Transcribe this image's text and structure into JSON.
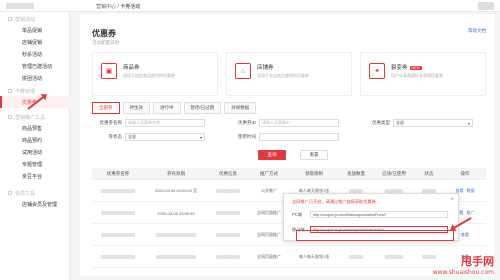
{
  "breadcrumb": {
    "root": "营销中心",
    "sep": "/",
    "current": "卡券活动"
  },
  "sidebar": {
    "group1": {
      "label": "营销活动",
      "items": [
        {
          "label": "单品促销"
        },
        {
          "label": "店铺促销"
        },
        {
          "label": "秒杀活动"
        },
        {
          "label": "管理已建活动"
        },
        {
          "label": "拼团活动"
        }
      ]
    },
    "group2": {
      "label": "卡券管理",
      "items": [
        {
          "label": "优惠券"
        }
      ]
    },
    "group3": {
      "label": "营销推广工具",
      "items": [
        {
          "label": "商品预售"
        },
        {
          "label": "商品预约"
        },
        {
          "label": "试用活动"
        },
        {
          "label": "专题管理"
        },
        {
          "label": "京豆平台"
        }
      ]
    },
    "group4": {
      "label": "会员工具",
      "items": [
        {
          "label": "店铺会员及管理"
        }
      ]
    }
  },
  "page": {
    "title": "优惠券",
    "subtitle": "活动配置说明",
    "help": "帮助文档"
  },
  "cards": [
    {
      "title": "商品券",
      "desc": "适用于指定商品使用的优惠券",
      "icon": "bag-icon",
      "badge": ""
    },
    {
      "title": "店铺券",
      "desc": "适用于全店商品使用的优惠券",
      "icon": "shop-icon",
      "badge": ""
    },
    {
      "title": "裂变券",
      "desc": "用户分享邀请好友获得优惠券",
      "icon": "fission-icon",
      "badge": "NEW"
    }
  ],
  "tabs": [
    {
      "label": "全部券"
    },
    {
      "label": "待生效"
    },
    {
      "label": "进行中"
    },
    {
      "label": "暂停/已过期"
    },
    {
      "label": "效果数据"
    }
  ],
  "filters": {
    "name_label": "优惠券名称",
    "name_placeholder": "请输入优惠券名称",
    "id_label": "优惠券ID",
    "id_placeholder": "请输入优惠券ID",
    "type_label": "优惠类型",
    "type_value": "全部",
    "shop_label": "券状态",
    "shop_value": "全部",
    "time_label": "使用时间",
    "time_placeholder": ""
  },
  "buttons": {
    "search": "查询",
    "reset": "重置"
  },
  "table": {
    "headers": [
      "优惠券名称",
      "券有效期",
      "优惠信息",
      "推广方式",
      "领取限制",
      "发放数量",
      "已领/已使用",
      "状态",
      "操作"
    ],
    "rows": [
      {
        "date": "2020-03-09 00:00:00 至",
        "method": "公开推广",
        "limit": "每人每天限领1张"
      },
      {
        "date": "2020-03-06 23:59:59",
        "method": "全网页面推广",
        "limit": "每人每天限领1张"
      },
      {
        "date": "",
        "method": "全网页面推广",
        "limit": "每人每天限领1张"
      },
      {
        "date": "",
        "method": "全网页面推广",
        "limit": "每人每天限领1张"
      }
    ],
    "ops": [
      "查看",
      "数据",
      "推广"
    ]
  },
  "popup": {
    "title": "全网推广已开启，请通过推广链接获取优惠券",
    "row1_label": "PC端",
    "row1_value": "http://coupon.jd.com/ilink/couponActiveFront/f",
    "row2_label": "移动端",
    "row2_value": "http://coupon.m.jd.com/coupons/show.action"
  },
  "watermark": {
    "big": "甩手网",
    "small": "www.shuaishou.com"
  }
}
